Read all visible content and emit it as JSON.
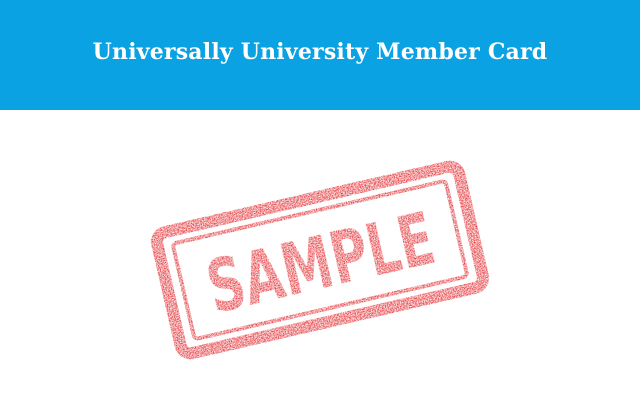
{
  "card": {
    "title": "Universally University Member Card",
    "header_color": "#0aa2e3"
  },
  "stamp": {
    "text": "SAMPLE",
    "color": "#e3262b"
  }
}
